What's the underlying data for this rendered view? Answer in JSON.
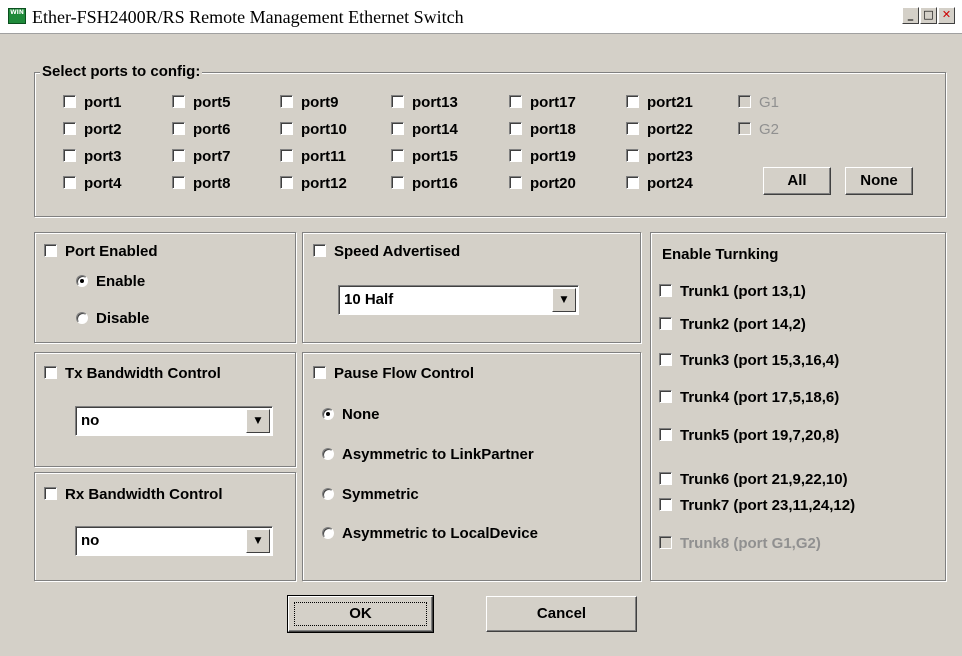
{
  "window": {
    "title": "Ether-FSH2400R/RS Remote Management Ethernet Switch",
    "icon_text": "WIN",
    "controls": [
      "minimize-icon",
      "maximize-icon",
      "close-icon"
    ]
  },
  "ports_group": {
    "legend": "Select ports to config:",
    "ports": [
      "port1",
      "port2",
      "port3",
      "port4",
      "port5",
      "port6",
      "port7",
      "port8",
      "port9",
      "port10",
      "port11",
      "port12",
      "port13",
      "port14",
      "port15",
      "port16",
      "port17",
      "port18",
      "port19",
      "port20",
      "port21",
      "port22",
      "port23",
      "port24"
    ],
    "gig_ports": [
      "G1",
      "G2"
    ],
    "all_label": "All",
    "none_label": "None"
  },
  "port_enabled": {
    "label": "Port Enabled",
    "options": [
      "Enable",
      "Disable"
    ],
    "selected": "Enable"
  },
  "speed": {
    "label": "Speed Advertised",
    "value": "10 Half"
  },
  "tx_bandwidth": {
    "label": "Tx Bandwidth Control",
    "value": "no"
  },
  "rx_bandwidth": {
    "label": "Rx Bandwidth Control",
    "value": "no"
  },
  "pause_flow": {
    "label": "Pause Flow Control",
    "options": [
      "None",
      "Asymmetric to LinkPartner",
      "Symmetric",
      "Asymmetric to LocalDevice"
    ],
    "selected": "None"
  },
  "trunking": {
    "title": "Enable  Turnking",
    "trunks": [
      "Trunk1 (port 13,1)",
      "Trunk2 (port 14,2)",
      "Trunk3 (port 15,3,16,4)",
      "Trunk4 (port 17,5,18,6)",
      "Trunk5 (port 19,7,20,8)",
      "Trunk6 (port 21,9,22,10)",
      "Trunk7 (port 23,11,24,12)",
      "Trunk8 (port G1,G2)"
    ],
    "disabled_trunk": "Trunk8 (port G1,G2)"
  },
  "buttons": {
    "ok": "OK",
    "cancel": "Cancel"
  }
}
